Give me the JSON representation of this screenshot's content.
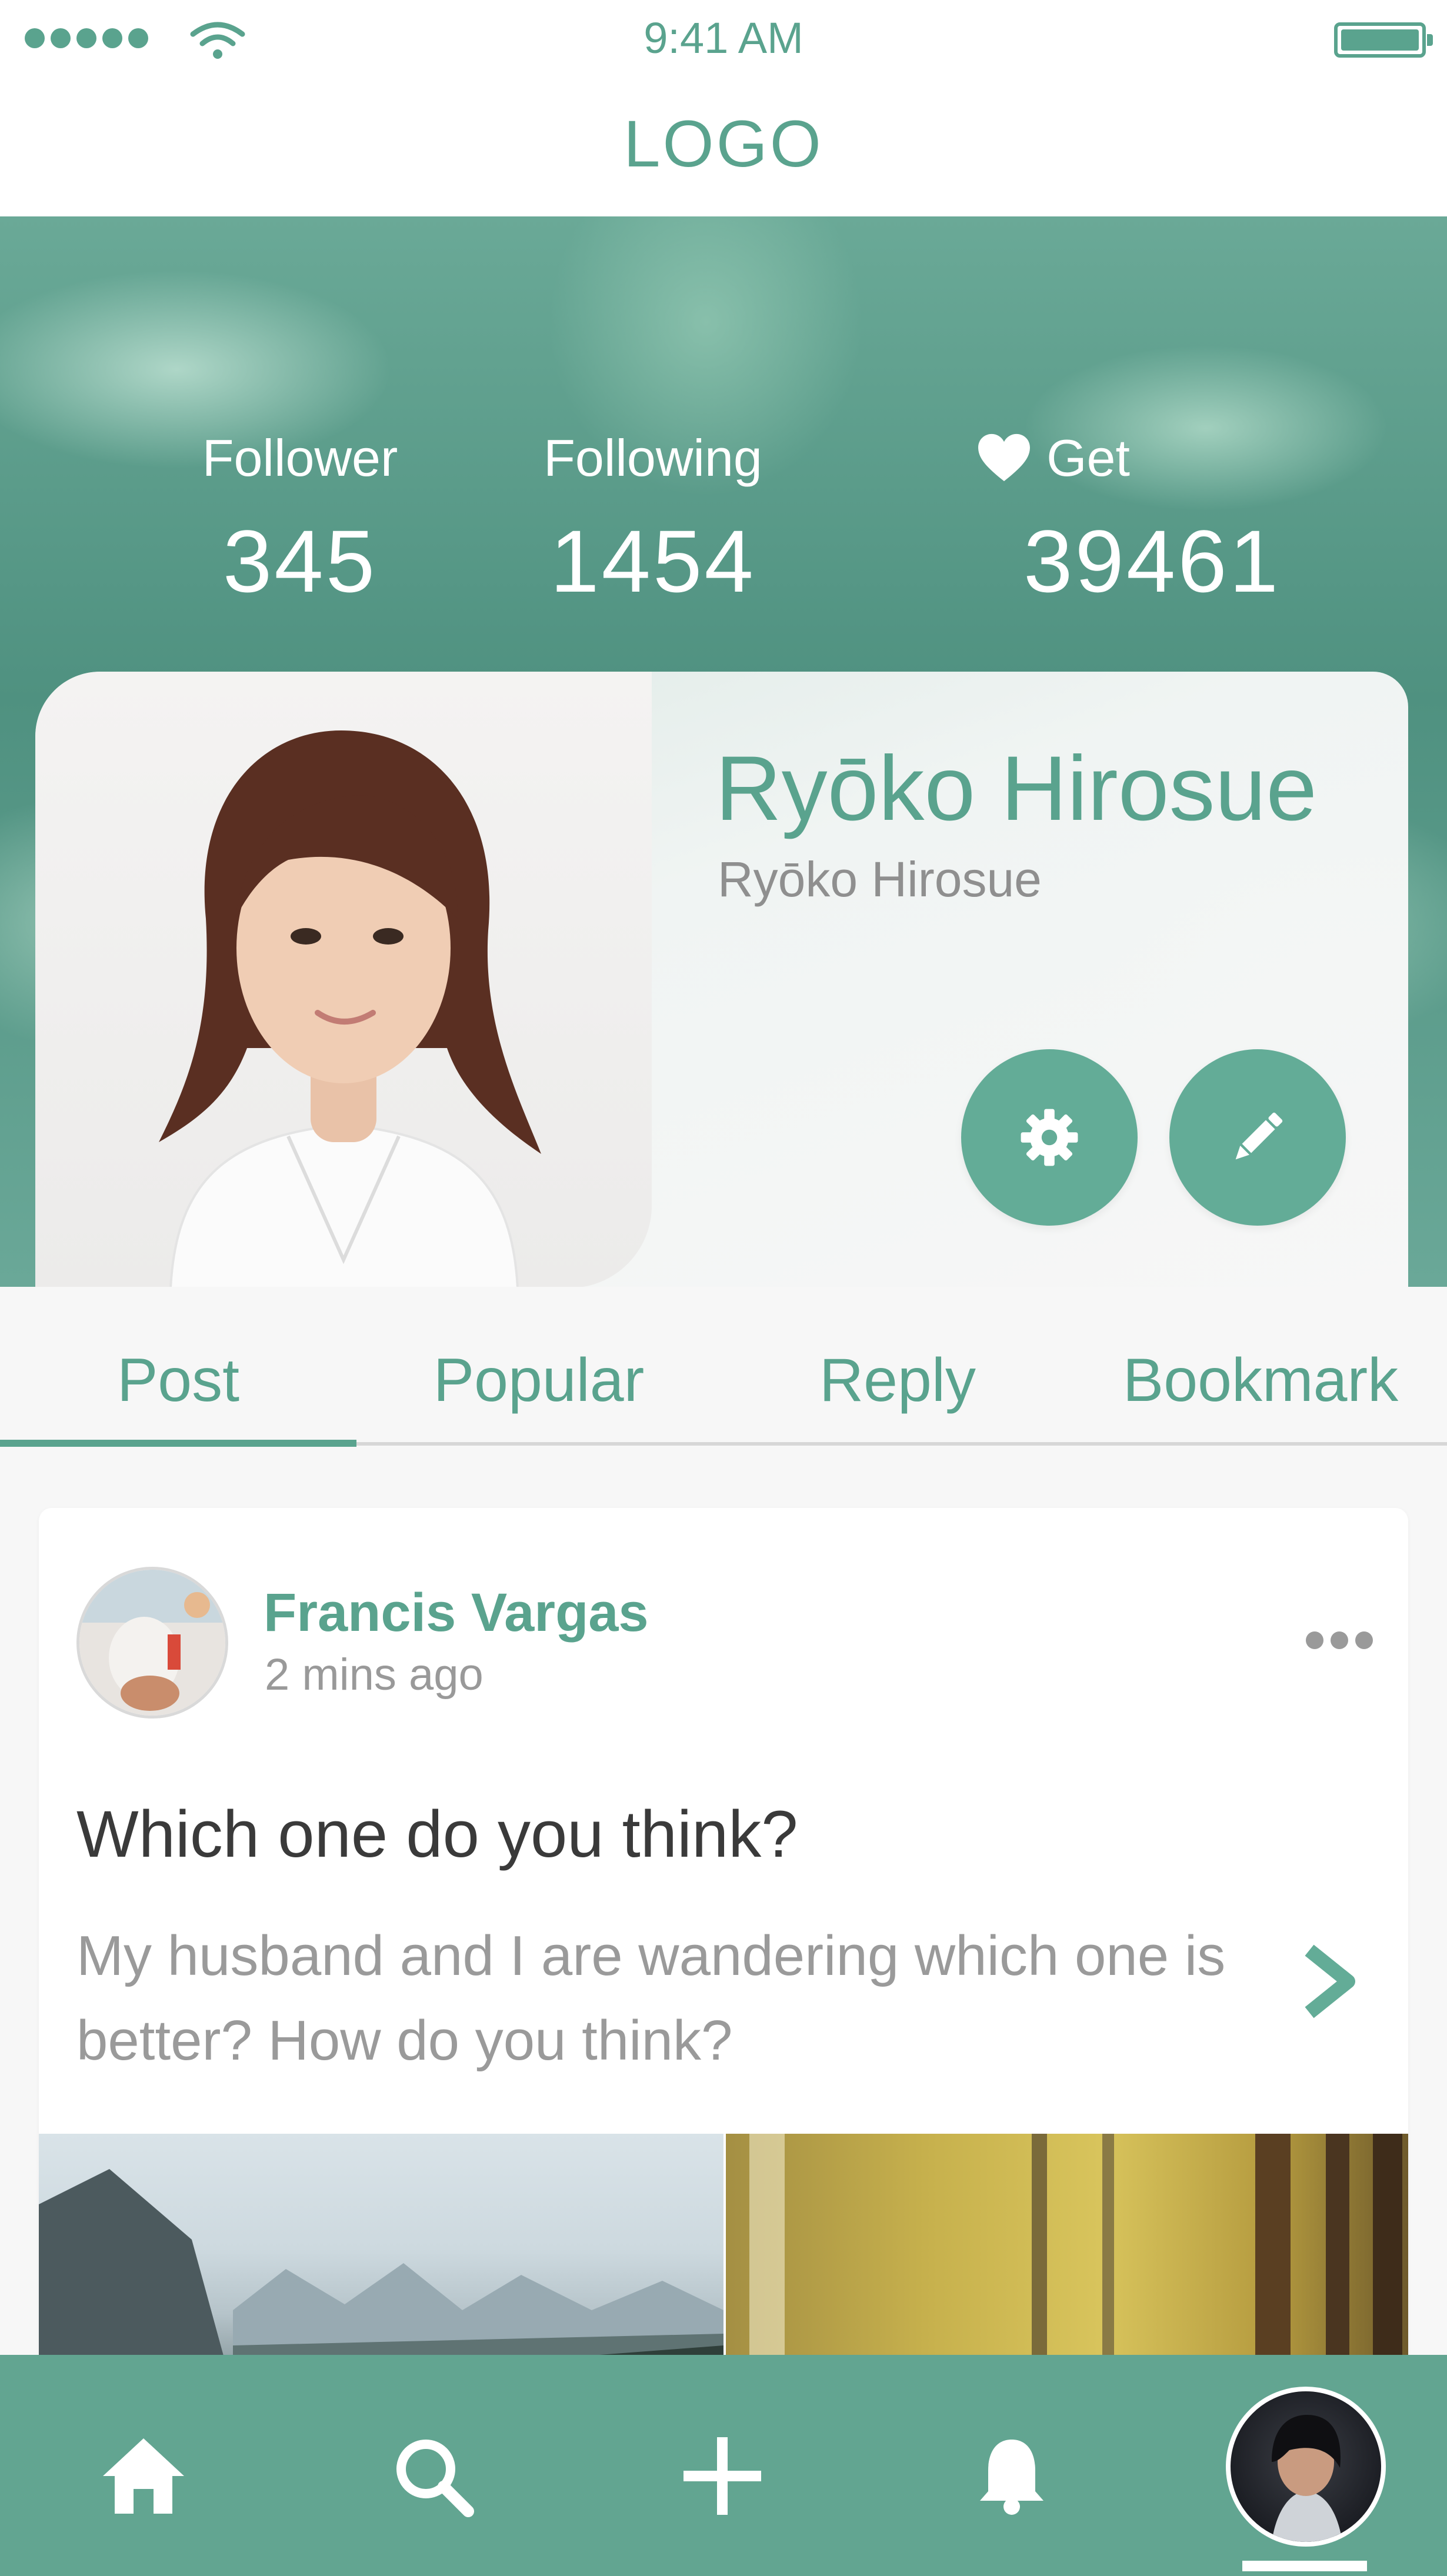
{
  "status_bar": {
    "time": "9:41 AM"
  },
  "header": {
    "logo": "LOGO"
  },
  "stats": [
    {
      "label": "Follower",
      "value": "345"
    },
    {
      "label": "Following",
      "value": "1454"
    },
    {
      "label": "Get",
      "value": "39461",
      "icon": "heart-icon"
    }
  ],
  "profile": {
    "name": "Ryōko Hirosue",
    "handle": "Ryōko Hirosue"
  },
  "tabs": [
    {
      "label": "Post",
      "active": true
    },
    {
      "label": "Popular",
      "active": false
    },
    {
      "label": "Reply",
      "active": false
    },
    {
      "label": "Bookmark",
      "active": false
    }
  ],
  "post": {
    "author": "Francis Vargas",
    "time": "2 mins ago",
    "title": "Which one do you think?",
    "body": "My husband and I are wandering which one is better? How do you think?"
  },
  "bottom_nav": [
    "home-icon",
    "search-icon",
    "add-icon",
    "bell-icon",
    "profile-avatar"
  ],
  "colors": {
    "accent": "#5aa38e",
    "nav_background": "#62a591",
    "text_muted": "#9a9a9a"
  }
}
